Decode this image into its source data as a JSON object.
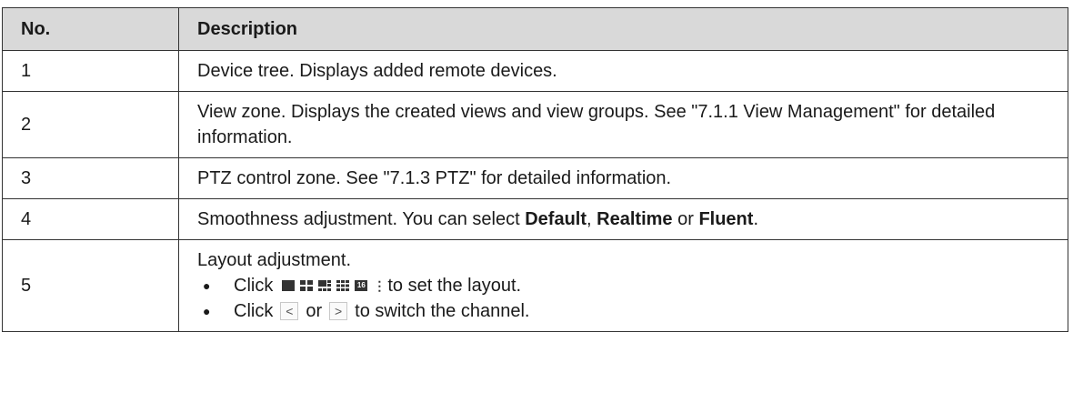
{
  "table": {
    "headers": [
      "No.",
      "Description"
    ],
    "rows": [
      {
        "no": "1",
        "text": "Device tree. Displays added remote devices."
      },
      {
        "no": "2",
        "text": "View zone. Displays the created views and view groups. See \"7.1.1 View Management\" for detailed information."
      },
      {
        "no": "3",
        "text": "PTZ control zone. See \"7.1.3 PTZ\" for detailed information."
      },
      {
        "no": "4",
        "text_before": "Smoothness adjustment. You can select ",
        "bold1": "Default",
        "sep1": ", ",
        "bold2": "Realtime",
        "sep2": " or ",
        "bold3": "Fluent",
        "text_after": "."
      },
      {
        "no": "5",
        "title": "Layout adjustment.",
        "bullet1": {
          "click": "Click",
          "after": "to set the layout.",
          "icons": [
            "single-view-icon",
            "four-view-icon",
            "six-view-icon",
            "nine-view-icon",
            "sixteen-view-icon",
            "more-icon"
          ],
          "sixteen_label": "16",
          "more_label": "⋮"
        },
        "bullet2": {
          "click": "Click",
          "prev": "<",
          "or": "or",
          "next": ">",
          "after": "to switch the channel."
        }
      }
    ]
  }
}
